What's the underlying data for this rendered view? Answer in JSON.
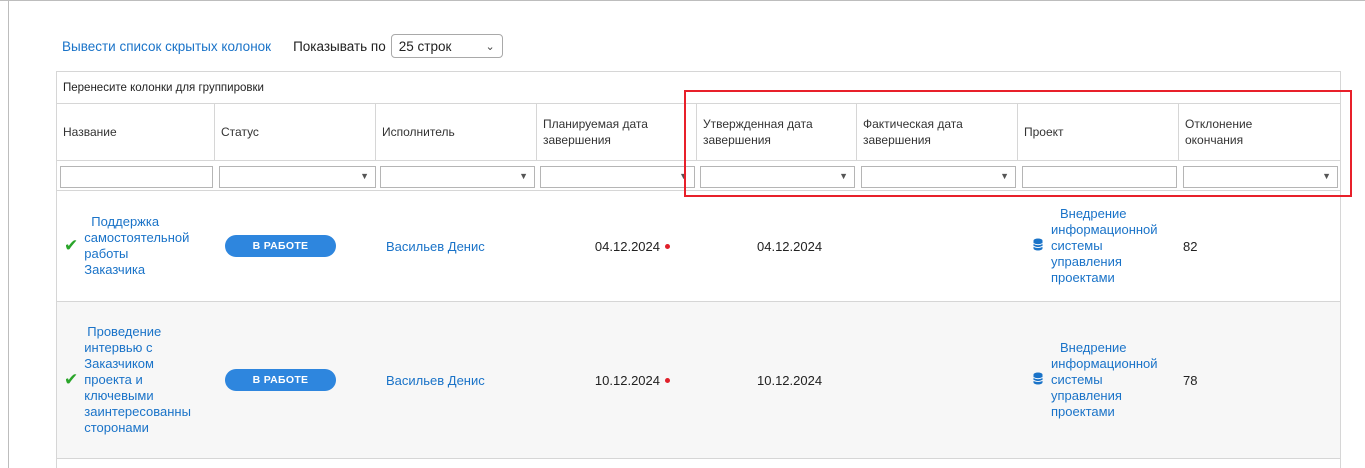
{
  "toolbar": {
    "hidden_columns_link": "Вывести список скрытых колонок",
    "show_label": "Показывать по",
    "page_size_value": "25 строк"
  },
  "grid": {
    "group_hint": "Перенесите колонки для группировки",
    "columns": [
      {
        "label": "Название"
      },
      {
        "label": "Статус"
      },
      {
        "label": "Исполнитель"
      },
      {
        "label": "Планируемая дата завершения"
      },
      {
        "label": "Утвержденная дата завершения"
      },
      {
        "label": "Фактическая дата завершения"
      },
      {
        "label": "Проект"
      },
      {
        "label": "Отклонение окончания"
      }
    ],
    "rows": [
      {
        "title_lines": [
          "Поддержка",
          "самостоятельной",
          "работы",
          "Заказчика"
        ],
        "status": "В РАБОТЕ",
        "assignee": "Васильев Денис",
        "planned_date": "04.12.2024",
        "approved_date": "04.12.2024",
        "actual_date": "",
        "project_lines": [
          "Внедрение",
          "информационной",
          "системы",
          "управления",
          "проектами"
        ],
        "deviation": "82"
      },
      {
        "title_lines": [
          "Проведение",
          "интервью с",
          "Заказчиком",
          "проекта и",
          "ключевыми",
          "заинтересованны",
          "сторонами"
        ],
        "status": "В РАБОТЕ",
        "assignee": "Васильев Денис",
        "planned_date": "10.12.2024",
        "approved_date": "10.12.2024",
        "actual_date": "",
        "project_lines": [
          "Внедрение",
          "информационной",
          "системы",
          "управления",
          "проектами"
        ],
        "deviation": "78"
      }
    ]
  },
  "colors": {
    "link": "#1a73c8",
    "badge": "#2e86de",
    "highlight": "#e8202a",
    "check": "#2aa52a",
    "overdue_dot": "#e0202a"
  },
  "icons": {
    "done": "check-icon",
    "project": "database-icon",
    "dropdown": "chevron-down-icon"
  }
}
